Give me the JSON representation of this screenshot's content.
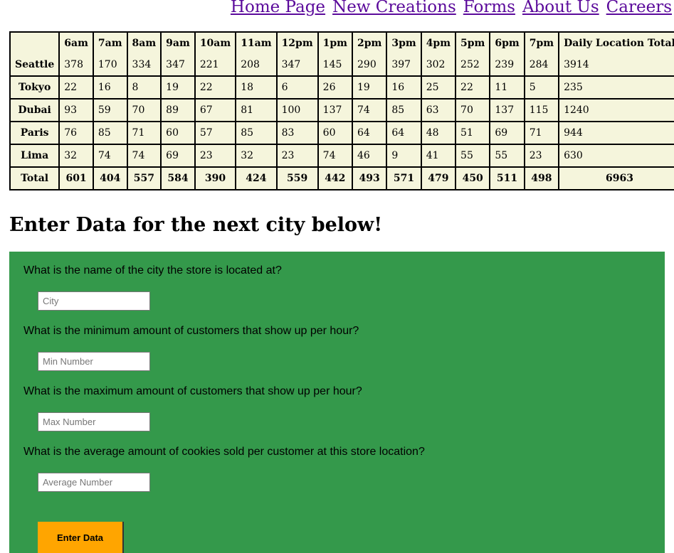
{
  "nav": {
    "items": [
      "Home Page",
      "New Creations",
      "Forms",
      "About Us",
      "Careers"
    ]
  },
  "sales_table": {
    "headers": [
      "",
      "6am",
      "7am",
      "8am",
      "9am",
      "10am",
      "11am",
      "12pm",
      "1pm",
      "2pm",
      "3pm",
      "4pm",
      "5pm",
      "6pm",
      "7pm",
      "Daily Location Total"
    ],
    "rows": [
      {
        "city": "Seattle",
        "values": [
          "378",
          "170",
          "334",
          "347",
          "221",
          "208",
          "347",
          "145",
          "290",
          "397",
          "302",
          "252",
          "239",
          "284",
          "3914"
        ]
      },
      {
        "city": "Tokyo",
        "values": [
          "22",
          "16",
          "8",
          "19",
          "22",
          "18",
          "6",
          "26",
          "19",
          "16",
          "25",
          "22",
          "11",
          "5",
          "235"
        ]
      },
      {
        "city": "Dubai",
        "values": [
          "93",
          "59",
          "70",
          "89",
          "67",
          "81",
          "100",
          "137",
          "74",
          "85",
          "63",
          "70",
          "137",
          "115",
          "1240"
        ]
      },
      {
        "city": "Paris",
        "values": [
          "76",
          "85",
          "71",
          "60",
          "57",
          "85",
          "83",
          "60",
          "64",
          "64",
          "48",
          "51",
          "69",
          "71",
          "944"
        ]
      },
      {
        "city": "Lima",
        "values": [
          "32",
          "74",
          "74",
          "69",
          "23",
          "32",
          "23",
          "74",
          "46",
          "9",
          "41",
          "55",
          "55",
          "23",
          "630"
        ]
      }
    ],
    "total_row": {
      "label": "Total",
      "values": [
        "601",
        "404",
        "557",
        "584",
        "390",
        "424",
        "559",
        "442",
        "493",
        "571",
        "479",
        "450",
        "511",
        "498",
        "6963"
      ]
    }
  },
  "form": {
    "heading": "Enter Data for the next city below!",
    "questions": [
      {
        "label": "What is the name of the city the store is located at?",
        "placeholder": "City",
        "value": ""
      },
      {
        "label": "What is the minimum amount of customers that show up per hour?",
        "placeholder": "Min Number",
        "value": ""
      },
      {
        "label": "What is the maximum amount of customers that show up per hour?",
        "placeholder": "Max Number",
        "value": ""
      },
      {
        "label": "What is the average amount of cookies sold per customer at this store location?",
        "placeholder": "Average Number",
        "value": ""
      }
    ],
    "submit_label": "Enter Data",
    "colors": {
      "panel": "#34994b",
      "button": "#ffa500",
      "table_cell": "#f5f5dc",
      "link": "#5b0a9b"
    }
  }
}
